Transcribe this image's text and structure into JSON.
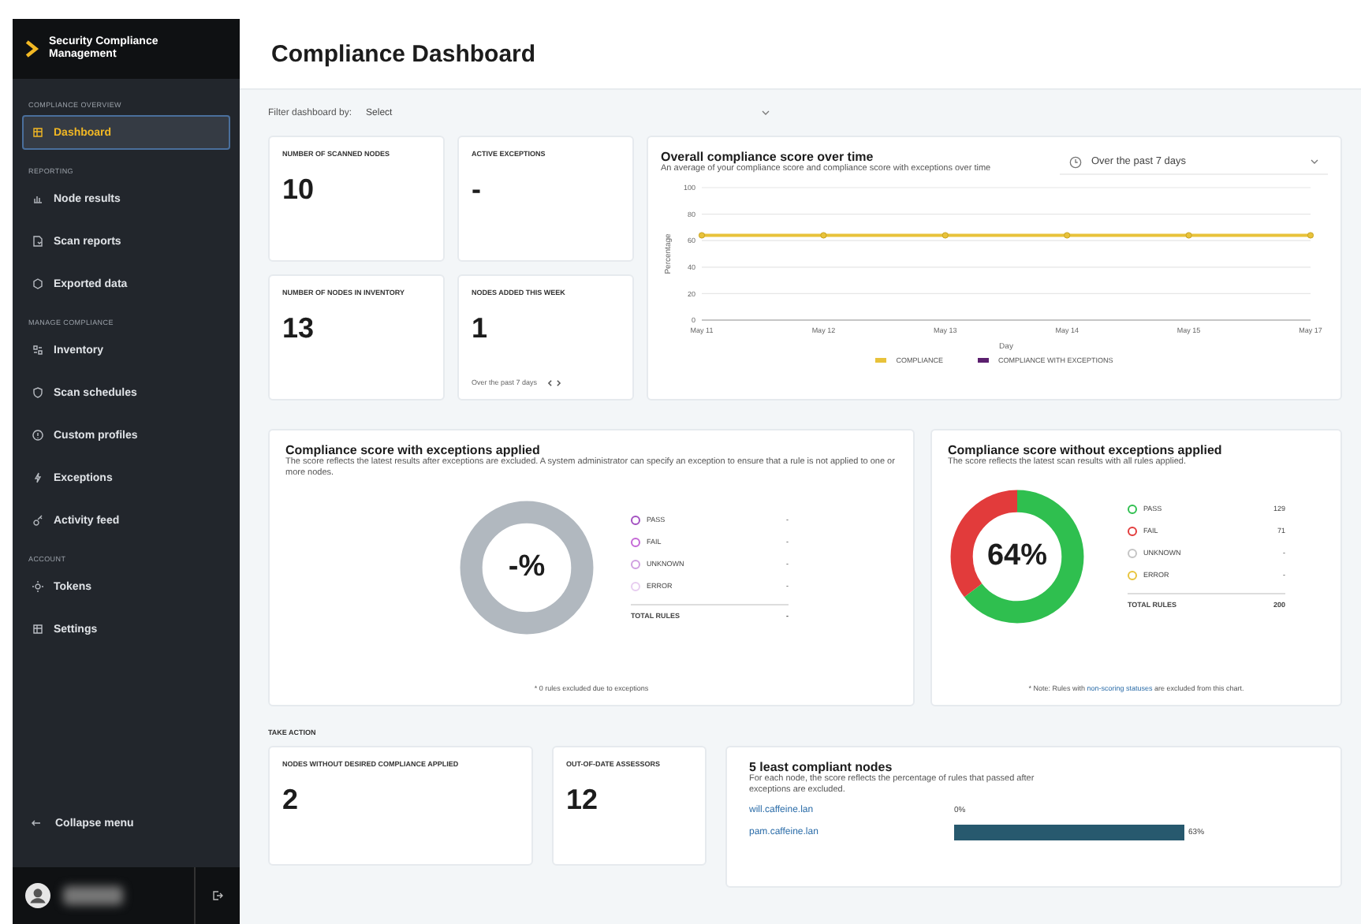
{
  "app": {
    "name": "Security Compliance Management"
  },
  "page": {
    "title": "Compliance Dashboard"
  },
  "sidebar": {
    "sections": [
      {
        "heading": "COMPLIANCE OVERVIEW",
        "items": [
          {
            "label": "Dashboard",
            "selected": true
          }
        ]
      },
      {
        "heading": "REPORTING",
        "items": [
          {
            "label": "Node results",
            "selected": false
          },
          {
            "label": "Scan reports",
            "selected": false
          },
          {
            "label": "Exported data",
            "selected": false
          }
        ]
      },
      {
        "heading": "MANAGE COMPLIANCE",
        "items": [
          {
            "label": "Inventory",
            "selected": false
          },
          {
            "label": "Scan schedules",
            "selected": false
          },
          {
            "label": "Custom profiles",
            "selected": false
          },
          {
            "label": "Exceptions",
            "selected": false
          },
          {
            "label": "Activity feed",
            "selected": false
          }
        ]
      },
      {
        "heading": "ACCOUNT",
        "items": [
          {
            "label": "Tokens",
            "selected": false
          },
          {
            "label": "Settings",
            "selected": false
          }
        ]
      }
    ],
    "collapse": "Collapse menu"
  },
  "filter": {
    "label": "Filter dashboard by:",
    "value": "Select"
  },
  "stats": [
    {
      "label": "NUMBER OF SCANNED NODES",
      "value": "10"
    },
    {
      "label": "ACTIVE EXCEPTIONS",
      "value": "-"
    },
    {
      "label": "NUMBER OF NODES IN INVENTORY",
      "value": "13"
    },
    {
      "label": "NODES ADDED THIS WEEK",
      "value": "1",
      "note": "Over the past 7 days"
    }
  ],
  "trend": {
    "title": "Overall compliance score over time",
    "subtitle": "An average of your compliance score and compliance score with exceptions over time",
    "range": "Over the past 7 days",
    "chart_data": {
      "type": "line",
      "xlabel": "Day",
      "ylabel": "Percentage",
      "categories": [
        "May 11",
        "May 12",
        "May 13",
        "May 14",
        "May 15",
        "May 17"
      ],
      "ylim": [
        0,
        100
      ],
      "yticks": [
        0,
        20,
        40,
        60,
        80,
        100
      ],
      "grid": true,
      "series": [
        {
          "name": "COMPLIANCE",
          "color": "#e8c23a",
          "marker": true,
          "values": [
            64,
            64,
            64,
            64,
            64,
            64
          ]
        },
        {
          "name": "COMPLIANCE WITH EXCEPTIONS",
          "color": "#5b1f6e",
          "values": [
            null,
            null,
            null,
            null,
            null,
            null
          ]
        }
      ]
    }
  },
  "scores": [
    {
      "title": "Compliance score with exceptions applied",
      "description": "The score reflects the latest results after exceptions are excluded. A system administrator can specify an exception to ensure that a rule is not applied to one or more nodes.",
      "center": "-%",
      "rules": [
        {
          "label": "PASS",
          "value": "-",
          "color": "#a24fc0"
        },
        {
          "label": "FAIL",
          "value": "-",
          "color": "#c467d6"
        },
        {
          "label": "UNKNOWN",
          "value": "-",
          "color": "#cf9ee0"
        },
        {
          "label": "ERROR",
          "value": "-",
          "color": "#e7cdf0"
        }
      ],
      "total_label": "TOTAL RULES",
      "total": "-",
      "footnote": {
        "before": "* 0 rules excluded due to exceptions"
      }
    },
    {
      "title": "Compliance score without exceptions applied",
      "description": "The score reflects the latest scan results with all rules applied.",
      "center": "64%",
      "rules": [
        {
          "label": "PASS",
          "value": "129",
          "color": "#2fbf4f"
        },
        {
          "label": "FAIL",
          "value": "71",
          "color": "#e23b3b"
        },
        {
          "label": "UNKNOWN",
          "value": "-",
          "color": "#c4c4c4"
        },
        {
          "label": "ERROR",
          "value": "-",
          "color": "#e8c43c"
        }
      ],
      "total_label": "TOTAL RULES",
      "total": "200",
      "footnote": {
        "before": "* Note: Rules with ",
        "link": "non-scoring statuses",
        "after": " are excluded from this chart."
      }
    }
  ],
  "take_action": {
    "heading": "TAKE ACTION",
    "cards": [
      {
        "label": "NODES WITHOUT DESIRED COMPLIANCE APPLIED",
        "value": "2"
      },
      {
        "label": "OUT-OF-DATE ASSESSORS",
        "value": "12"
      }
    ],
    "least": {
      "title": "5 least compliant nodes",
      "description": "For each node, the score reflects the percentage of rules that passed after exceptions are excluded.",
      "nodes": [
        {
          "name": "will.caffeine.lan",
          "reading": "0%"
        },
        {
          "name": "pam.caffeine.lan",
          "reading": "63%"
        }
      ]
    }
  }
}
